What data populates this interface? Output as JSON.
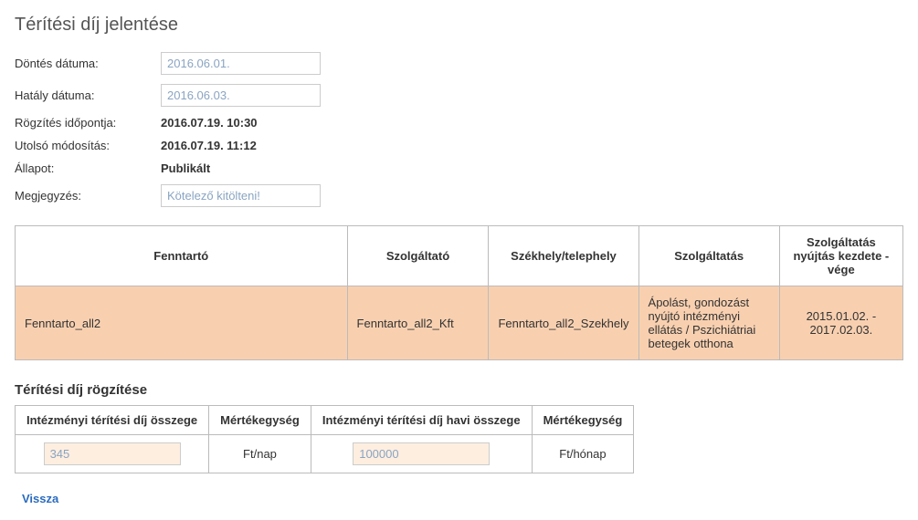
{
  "page_title": "Térítési díj jelentése",
  "form": {
    "decision_date": {
      "label": "Döntés dátuma:",
      "value": "2016.06.01."
    },
    "effective_date": {
      "label": "Hatály dátuma:",
      "value": "2016.06.03."
    },
    "recorded_at": {
      "label": "Rögzítés időpontja:",
      "value": "2016.07.19. 10:30"
    },
    "last_modified": {
      "label": "Utolsó módosítás:",
      "value": "2016.07.19. 11:12"
    },
    "status": {
      "label": "Állapot:",
      "value": "Publikált"
    },
    "note": {
      "label": "Megjegyzés:",
      "placeholder": "Kötelező kitölteni!"
    }
  },
  "main_table": {
    "headers": {
      "maintainer": "Fenntartó",
      "provider": "Szolgáltató",
      "site": "Székhely/telephely",
      "service": "Szolgáltatás",
      "period": "Szolgáltatás nyújtás kezdete - vége"
    },
    "row": {
      "maintainer": "Fenntarto_all2",
      "provider": "Fenntarto_all2_Kft",
      "site": "Fenntarto_all2_Szekhely",
      "service": "Ápolást, gondozást nyújtó intézményi ellátás / Pszichiátriai betegek otthona",
      "period": "2015.01.02. - 2017.02.03."
    }
  },
  "fee_section": {
    "title": "Térítési díj rögzítése",
    "headers": {
      "inst_fee": "Intézményi térítési díj összege",
      "unit1": "Mértékegység",
      "inst_fee_monthly": "Intézményi térítési díj havi összege",
      "unit2": "Mértékegység"
    },
    "values": {
      "inst_fee": "345",
      "unit1": "Ft/nap",
      "inst_fee_monthly": "100000",
      "unit2": "Ft/hónap"
    }
  },
  "back_label": "Vissza"
}
